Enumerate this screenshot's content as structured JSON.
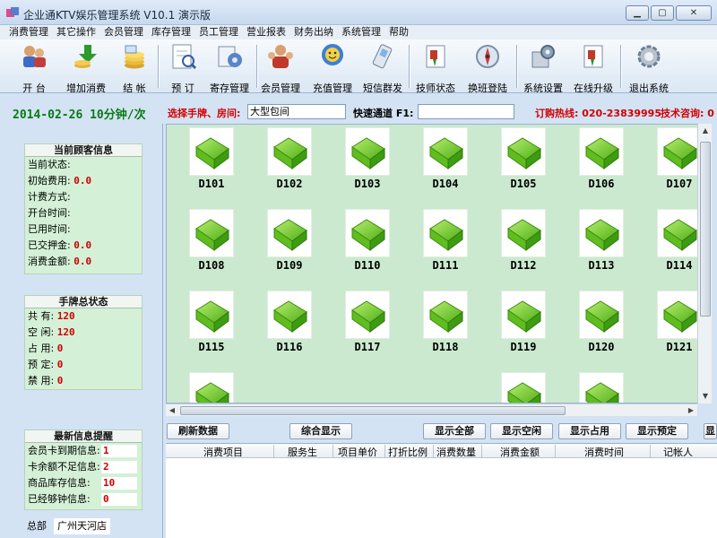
{
  "window": {
    "title": "企业通KTV娱乐管理系统 V10.1  演示版",
    "controls": [
      "minimize",
      "maximize",
      "close"
    ]
  },
  "menu": [
    "消费管理",
    "其它操作",
    "会员管理",
    "库存管理",
    "员工管理",
    "营业报表",
    "财务出纳",
    "系统管理",
    "帮助"
  ],
  "toolbar": [
    {
      "label": "开 台",
      "icon": "open-table-icon"
    },
    {
      "label": "增加消费",
      "icon": "add-consumption-icon"
    },
    {
      "label": "结 帐",
      "icon": "checkout-icon"
    },
    {
      "label": "预 订",
      "icon": "reservation-icon"
    },
    {
      "label": "寄存管理",
      "icon": "storage-icon"
    },
    {
      "label": "会员管理",
      "icon": "members-icon"
    },
    {
      "label": "充值管理",
      "icon": "recharge-icon"
    },
    {
      "label": "短信群发",
      "icon": "sms-icon"
    },
    {
      "label": "技师状态",
      "icon": "technician-icon"
    },
    {
      "label": "换班登陆",
      "icon": "shift-change-icon"
    },
    {
      "label": "系统设置",
      "icon": "settings-icon"
    },
    {
      "label": "在线升级",
      "icon": "online-upgrade-icon"
    },
    {
      "label": "退出系统",
      "icon": "exit-icon"
    }
  ],
  "infobar": {
    "datetime": "2014-02-26  10分钟/次",
    "select_label": "选择手牌、房间:",
    "select_value": "大型包间",
    "quick_label": "快速通道 F1:",
    "quick_value": "",
    "hotline": "订购热线: 020-23839995",
    "tech": "技术咨询: 0"
  },
  "customer_info": {
    "title": "当前顾客信息",
    "rows": [
      {
        "label": "当前状态:",
        "value": ""
      },
      {
        "label": "初始费用:",
        "value": "0.0"
      },
      {
        "label": "计费方式:",
        "value": ""
      },
      {
        "label": "开台时间:",
        "value": ""
      },
      {
        "label": "已用时间:",
        "value": ""
      },
      {
        "label": "已交押金:",
        "value": "0.0"
      },
      {
        "label": "消费金额:",
        "value": "0.0"
      }
    ]
  },
  "tag_status": {
    "title": "手牌总状态",
    "rows": [
      {
        "label": "共    有:",
        "value": "120"
      },
      {
        "label": "空    闲:",
        "value": "120"
      },
      {
        "label": "占    用:",
        "value": "0"
      },
      {
        "label": "预    定:",
        "value": "0"
      },
      {
        "label": "禁    用:",
        "value": "0"
      }
    ]
  },
  "alerts": {
    "title": "最新信息提醒",
    "rows": [
      {
        "label": "会员卡到期信息:",
        "value": "1"
      },
      {
        "label": "卡余额不足信息:",
        "value": "2"
      },
      {
        "label": "商品库存信息:",
        "value": "10"
      },
      {
        "label": "已经够钟信息:",
        "value": "0"
      }
    ]
  },
  "branch": {
    "label": "总部",
    "value": "广州天河店"
  },
  "rooms": [
    "D101",
    "D102",
    "D103",
    "D104",
    "D105",
    "D106",
    "D107",
    "D108",
    "D109",
    "D110",
    "D111",
    "D112",
    "D113",
    "D114",
    "D115",
    "D116",
    "D117",
    "D118",
    "D119",
    "D120",
    "D121",
    "",
    "",
    "",
    "",
    "",
    "",
    ""
  ],
  "buttons": {
    "refresh": "刷新数据",
    "summary": "综合显示",
    "show_all": "显示全部",
    "show_free": "显示空闲",
    "show_occupied": "显示占用",
    "show_reserved": "显示预定",
    "show_more": "显"
  },
  "grid_columns": [
    "消费项目",
    "服务生",
    "项目单价",
    "打折比例",
    "消费数量",
    "消费金额",
    "消费时间",
    "记帐人"
  ],
  "colors": {
    "accent_red": "#d00000",
    "date_green": "#087a17",
    "panel_green": "#d4f0d6",
    "room_area": "#cbe9ce",
    "room_icon_green": "#7ccd2f"
  }
}
